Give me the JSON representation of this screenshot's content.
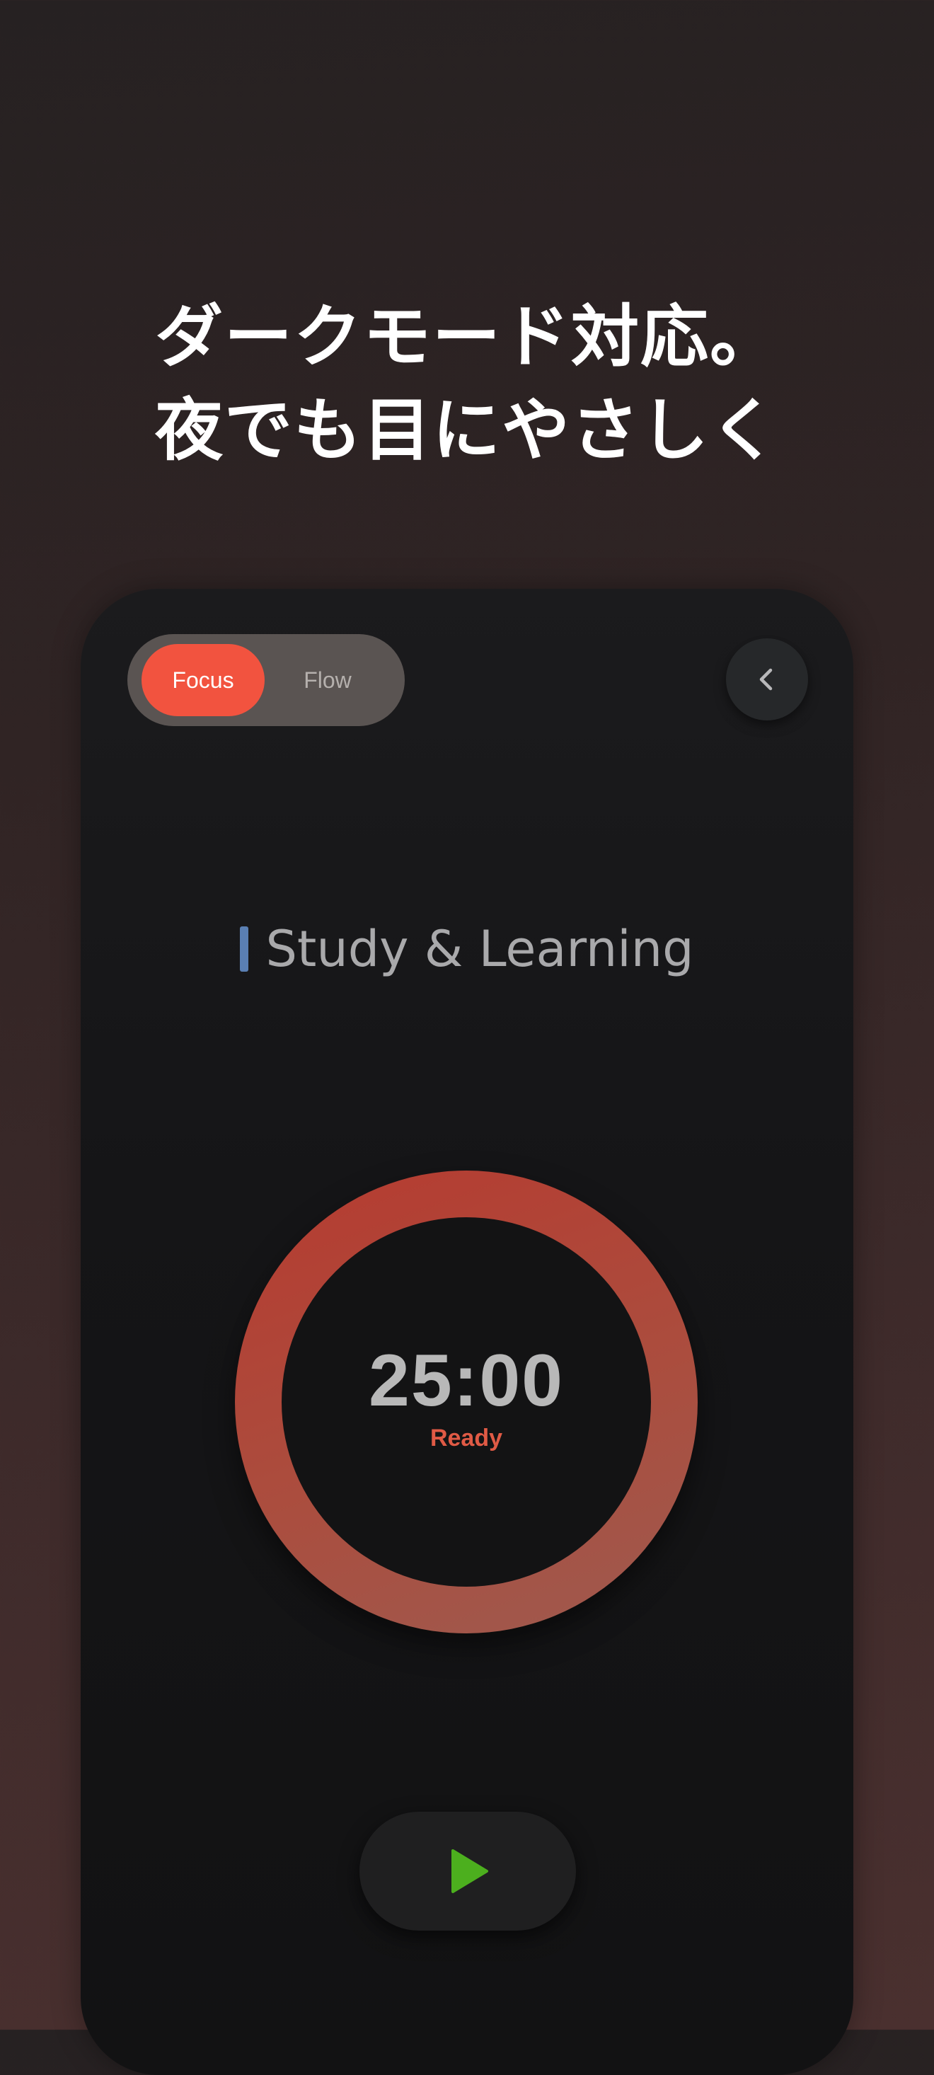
{
  "headline": {
    "line1": "ダークモード対応。",
    "line2": "夜でも目にやさしく"
  },
  "mode_toggle": {
    "focus_label": "Focus",
    "flow_label": "Flow",
    "selected": "Focus"
  },
  "category": {
    "label": "Study & Learning",
    "color": "#5a7fb3"
  },
  "timer": {
    "time": "25:00",
    "status": "Ready",
    "ring_color": "#b63b30",
    "status_color": "#e05a45"
  },
  "icons": {
    "back": "chevron-left-icon",
    "play": "play-icon"
  },
  "colors": {
    "accent": "#f2533f",
    "play": "#4caf1e"
  }
}
